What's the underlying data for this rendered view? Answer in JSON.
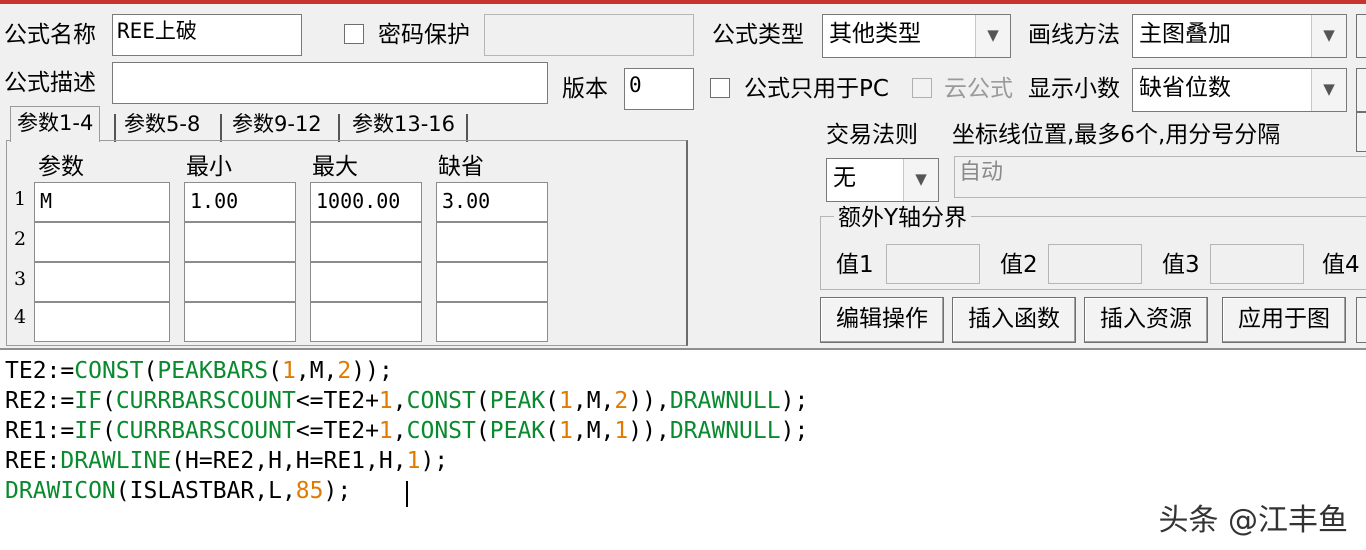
{
  "window": {
    "accent_color": "#c8322f"
  },
  "form": {
    "name_label": "公式名称",
    "name_value": "REE上破",
    "password_label": "密码保护",
    "password_value": "",
    "type_label": "公式类型",
    "type_value": "其他类型",
    "draw_method_label": "画线方法",
    "draw_method_value": "主图叠加",
    "desc_label": "公式描述",
    "desc_value": "",
    "version_label": "版本",
    "version_value": "0",
    "pc_only_label": "公式只用于PC",
    "cloud_label": "云公式",
    "decimals_label": "显示小数",
    "decimals_value": "缺省位数"
  },
  "tabs": [
    "参数1-4",
    "参数5-8",
    "参数9-12",
    "参数13-16"
  ],
  "params": {
    "headers": [
      "参数",
      "最小",
      "最大",
      "缺省"
    ],
    "rows": [
      {
        "num": "1",
        "name": "M",
        "min": "1.00",
        "max": "1000.00",
        "default": "3.00"
      },
      {
        "num": "2",
        "name": "",
        "min": "",
        "max": "",
        "default": ""
      },
      {
        "num": "3",
        "name": "",
        "min": "",
        "max": "",
        "default": ""
      },
      {
        "num": "4",
        "name": "",
        "min": "",
        "max": "",
        "default": ""
      }
    ]
  },
  "trade": {
    "rule_label": "交易法则",
    "rule_value": "无",
    "axis_label": "坐标线位置,最多6个,用分号分隔",
    "axis_value": "自动"
  },
  "y_axis": {
    "title": "额外Y轴分界",
    "labels": [
      "值1",
      "值2",
      "值3",
      "值4"
    ]
  },
  "buttons": {
    "edit": "编辑操作",
    "insert_func": "插入函数",
    "insert_res": "插入资源",
    "apply": "应用于图"
  },
  "code": {
    "keyword_color": "#0a8a2e",
    "number_color": "#e07b00",
    "lines": [
      [
        [
          "p",
          "TE2:="
        ],
        [
          "k",
          "CONST"
        ],
        [
          "p",
          "("
        ],
        [
          "k",
          "PEAKBARS"
        ],
        [
          "p",
          "("
        ],
        [
          "n",
          "1"
        ],
        [
          "p",
          ",M,"
        ],
        [
          "n",
          "2"
        ],
        [
          "p",
          "));"
        ]
      ],
      [
        [
          "p",
          "RE2:="
        ],
        [
          "k",
          "IF"
        ],
        [
          "p",
          "("
        ],
        [
          "k",
          "CURRBARSCOUNT"
        ],
        [
          "p",
          "<=TE2+"
        ],
        [
          "n",
          "1"
        ],
        [
          "p",
          ","
        ],
        [
          "k",
          "CONST"
        ],
        [
          "p",
          "("
        ],
        [
          "k",
          "PEAK"
        ],
        [
          "p",
          "("
        ],
        [
          "n",
          "1"
        ],
        [
          "p",
          ",M,"
        ],
        [
          "n",
          "2"
        ],
        [
          "p",
          ")),"
        ],
        [
          "k",
          "DRAWNULL"
        ],
        [
          "p",
          ");"
        ]
      ],
      [
        [
          "p",
          "RE1:="
        ],
        [
          "k",
          "IF"
        ],
        [
          "p",
          "("
        ],
        [
          "k",
          "CURRBARSCOUNT"
        ],
        [
          "p",
          "<=TE2+"
        ],
        [
          "n",
          "1"
        ],
        [
          "p",
          ","
        ],
        [
          "k",
          "CONST"
        ],
        [
          "p",
          "("
        ],
        [
          "k",
          "PEAK"
        ],
        [
          "p",
          "("
        ],
        [
          "n",
          "1"
        ],
        [
          "p",
          ",M,"
        ],
        [
          "n",
          "1"
        ],
        [
          "p",
          ")),"
        ],
        [
          "k",
          "DRAWNULL"
        ],
        [
          "p",
          ");"
        ]
      ],
      [
        [
          "p",
          "REE:"
        ],
        [
          "k",
          "DRAWLINE"
        ],
        [
          "p",
          "(H=RE2,H,H=RE1,H,"
        ],
        [
          "n",
          "1"
        ],
        [
          "p",
          ");"
        ]
      ],
      [
        [
          "k",
          "DRAWICON"
        ],
        [
          "p",
          "(ISLASTBAR,L,"
        ],
        [
          "n",
          "85"
        ],
        [
          "p",
          ");"
        ]
      ]
    ]
  },
  "watermark": "头条 @江丰鱼"
}
